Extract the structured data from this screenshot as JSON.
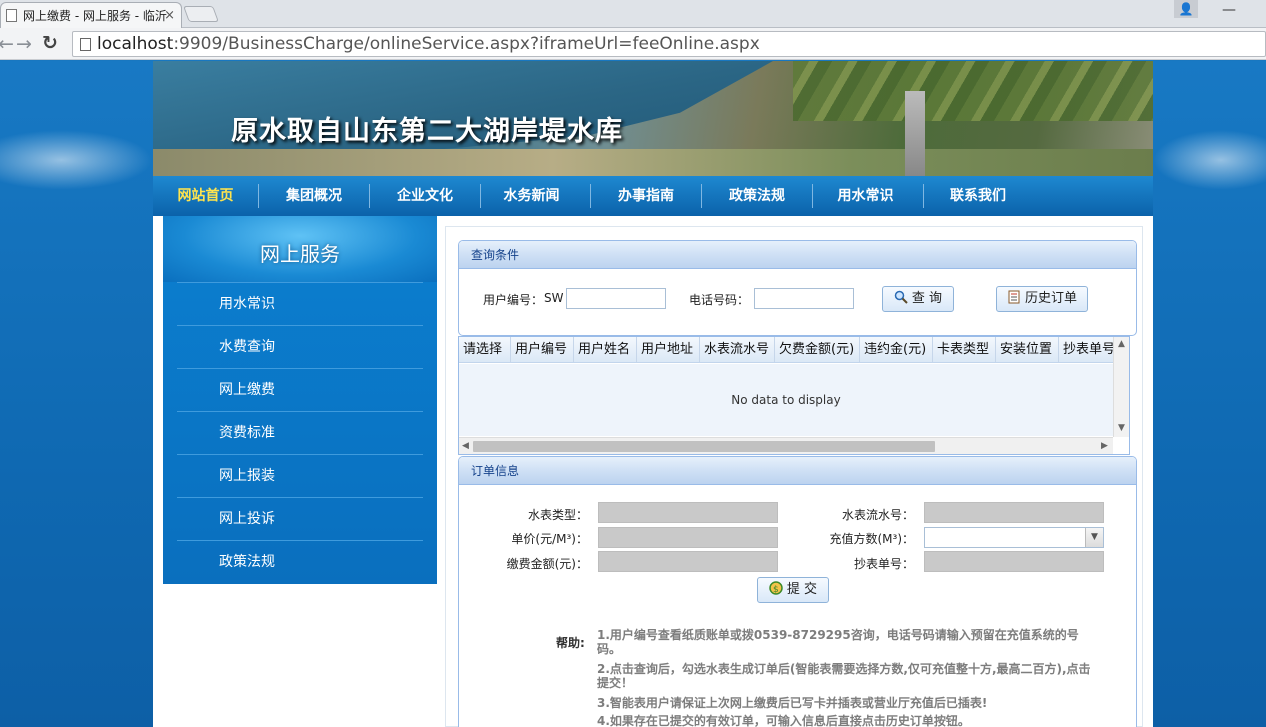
{
  "browser": {
    "tab_title": "网上缴费 - 网上服务 - 临沂",
    "tab_close": "×",
    "url_host": "localhost",
    "url_rest": ":9909/BusinessCharge/onlineService.aspx?iframeUrl=feeOnline.aspx",
    "minimize": "—",
    "close": "×"
  },
  "banner": {
    "title": "原水取自山东第二大湖岸堤水库"
  },
  "mainnav": {
    "items": [
      "网站首页",
      "集团概况",
      "企业文化",
      "水务新闻",
      "办事指南",
      "政策法规",
      "用水常识",
      "联系我们"
    ],
    "active_color": "#ffe44d"
  },
  "sidebar": {
    "title": "网上服务",
    "items": [
      "用水常识",
      "水费查询",
      "网上缴费",
      "资费标准",
      "网上报装",
      "网上投诉",
      "政策法规"
    ]
  },
  "query": {
    "title": "查询条件",
    "user_no_label": "用户编号：",
    "user_no_prefix": "SW",
    "user_no_value": "",
    "phone_label": "电话号码：",
    "phone_value": "",
    "search_button": "查 询",
    "history_button": "历史订单"
  },
  "grid": {
    "columns": [
      "请选择",
      "用户编号",
      "用户姓名",
      "用户地址",
      "水表流水号",
      "欠费金额(元)",
      "违约金(元)",
      "卡表类型",
      "安装位置",
      "抄表单号"
    ],
    "empty_text": "No data to display"
  },
  "order": {
    "title": "订单信息",
    "meter_type_label": "水表类型：",
    "meter_serial_label": "水表流水号：",
    "unit_price_label": "单价(元/M³)：",
    "recharge_label": "充值方数(M³)：",
    "payment_label": "缴费金额(元)：",
    "reading_no_label": "抄表单号：",
    "submit_button": "提 交"
  },
  "help": {
    "label": "帮助:",
    "lines": [
      "1.用户编号查看纸质账单或拨0539-8729295咨询，电话号码请输入预留在充值系统的号码。",
      "2.点击查询后，勾选水表生成订单后(智能表需要选择方数,仅可充值整十方,最高二百方),点击提交！",
      "3.智能表用户请保证上次网上缴费后已写卡并插表或营业厅充值后已插表!",
      "4.如果存在已提交的有效订单，可输入信息后直接点击历史订单按钮。"
    ]
  }
}
